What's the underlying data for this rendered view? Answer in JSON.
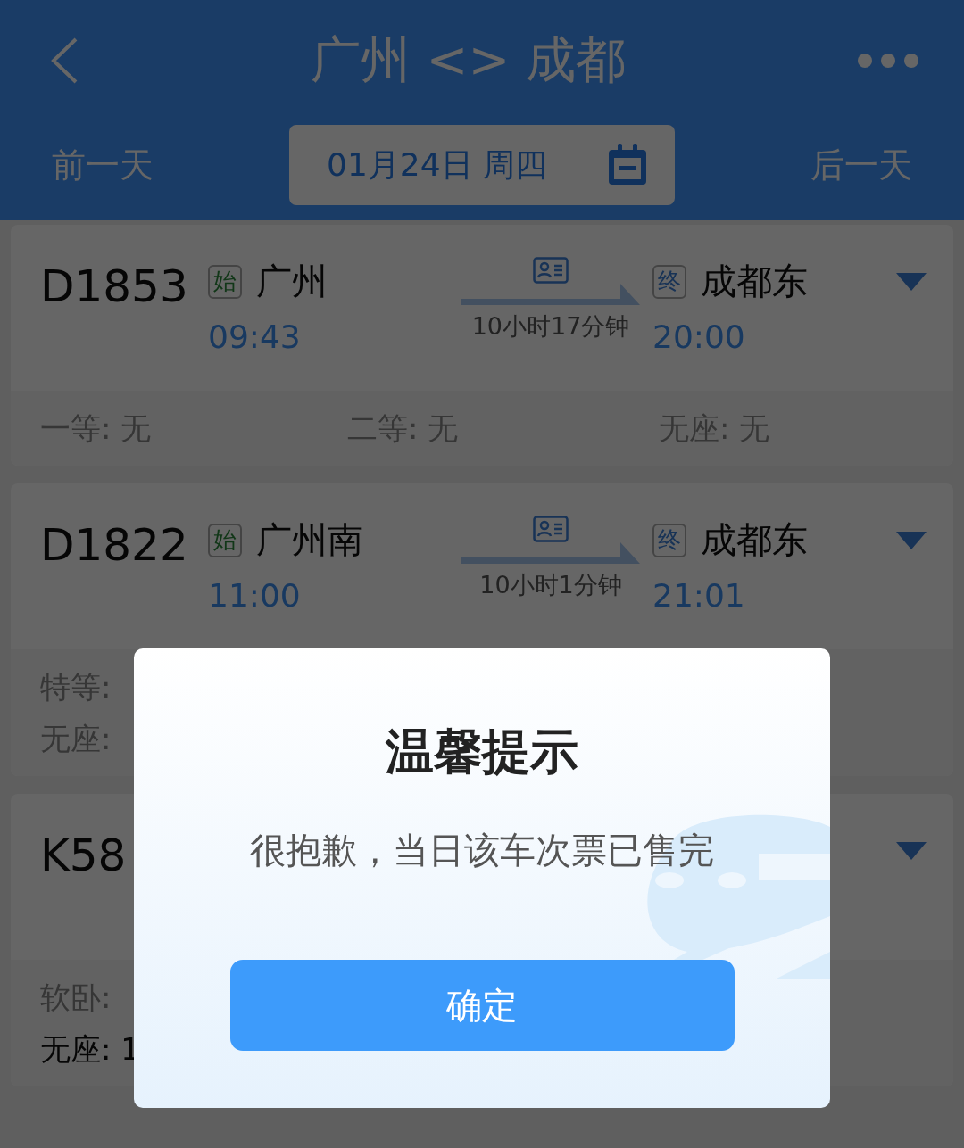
{
  "header": {
    "title": "广州 <> 成都",
    "prev_day": "前一天",
    "date": "01月24日 周四",
    "next_day": "后一天"
  },
  "trains": [
    {
      "number": "D1853",
      "from": {
        "kind": "start",
        "tag": "始",
        "name": "广州",
        "time": "09:43"
      },
      "duration": "10小时17分钟",
      "to": {
        "kind": "end",
        "tag": "终",
        "name": "成都东",
        "time": "20:00"
      },
      "seat_rows": [
        [
          {
            "text": "一等: 无",
            "available": false
          },
          {
            "text": "二等: 无",
            "available": false
          },
          {
            "text": "无座: 无",
            "available": false
          }
        ]
      ]
    },
    {
      "number": "D1822",
      "from": {
        "kind": "start",
        "tag": "始",
        "name": "广州南",
        "time": "11:00"
      },
      "duration": "10小时1分钟",
      "to": {
        "kind": "end",
        "tag": "终",
        "name": "成都东",
        "time": "21:01"
      },
      "seat_rows": [
        [
          {
            "text": "特等:",
            "available": false
          }
        ],
        [
          {
            "text": "无座:",
            "available": false
          }
        ]
      ]
    },
    {
      "number": "K58",
      "seat_rows": [
        [
          {
            "text": "软卧:",
            "available": false
          }
        ],
        [
          {
            "text": "无座: 1",
            "available": true
          }
        ]
      ]
    }
  ],
  "dialog": {
    "title": "温馨提示",
    "message": "很抱歉，当日该车次票已售完",
    "confirm": "确定"
  }
}
